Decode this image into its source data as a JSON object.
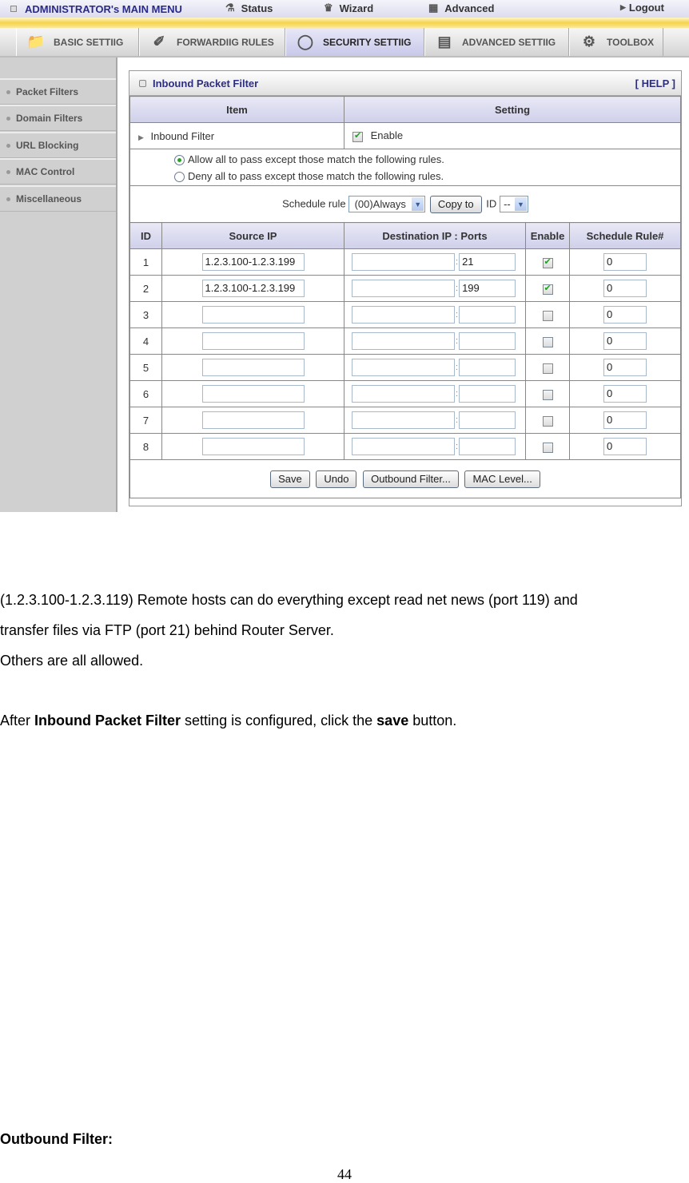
{
  "topbar": {
    "title": "ADMINISTRATOR's MAIN MENU",
    "items": [
      {
        "label": "Status",
        "icon": "status-icon"
      },
      {
        "label": "Wizard",
        "icon": "wizard-icon"
      },
      {
        "label": "Advanced",
        "icon": "advanced-icon"
      },
      {
        "label": "Logout",
        "icon": "arrow-right-icon"
      }
    ]
  },
  "tabs": [
    {
      "label": "BASIC SETTIIG",
      "icon": "folder-icon",
      "active": false
    },
    {
      "label": "FORWARDIIG RULES",
      "icon": "forwarding-icon",
      "active": false
    },
    {
      "label": "SECURITY SETTIIG",
      "icon": "lock-icon",
      "active": true
    },
    {
      "label": "ADVANCED SETTIIG",
      "icon": "advanced-setting-icon",
      "active": false
    },
    {
      "label": "TOOLBOX",
      "icon": "toolbox-icon",
      "active": false
    }
  ],
  "sidebar": {
    "items": [
      {
        "label": "Packet Filters"
      },
      {
        "label": "Domain Filters"
      },
      {
        "label": "URL Blocking"
      },
      {
        "label": "MAC Control"
      },
      {
        "label": "Miscellaneous"
      }
    ]
  },
  "panel": {
    "title": "Inbound Packet Filter",
    "help": "[ HELP ]",
    "header": {
      "item": "Item",
      "setting": "Setting"
    },
    "filter_label": "Inbound Filter",
    "enable_label": "Enable",
    "enable_checked": true,
    "rule_options": [
      {
        "label": "Allow all to pass except those match the following rules.",
        "selected": true
      },
      {
        "label": "Deny all to pass except those match the following rules.",
        "selected": false
      }
    ],
    "schedule_label": "Schedule rule",
    "schedule_value": "(00)Always",
    "copy_to_label": "Copy to",
    "id_label": "ID",
    "id_value": "--",
    "columns": [
      "ID",
      "Source IP",
      "Destination IP : Ports",
      "Enable",
      "Schedule Rule#"
    ],
    "rows": [
      {
        "id": "1",
        "source_ip": "1.2.3.100-1.2.3.199",
        "dest_ip": "",
        "port": "21",
        "enabled": true,
        "schedule": "0"
      },
      {
        "id": "2",
        "source_ip": "1.2.3.100-1.2.3.199",
        "dest_ip": "",
        "port": "199",
        "enabled": true,
        "schedule": "0"
      },
      {
        "id": "3",
        "source_ip": "",
        "dest_ip": "",
        "port": "",
        "enabled": false,
        "schedule": "0"
      },
      {
        "id": "4",
        "source_ip": "",
        "dest_ip": "",
        "port": "",
        "enabled": false,
        "schedule": "0"
      },
      {
        "id": "5",
        "source_ip": "",
        "dest_ip": "",
        "port": "",
        "enabled": false,
        "schedule": "0"
      },
      {
        "id": "6",
        "source_ip": "",
        "dest_ip": "",
        "port": "",
        "enabled": false,
        "schedule": "0"
      },
      {
        "id": "7",
        "source_ip": "",
        "dest_ip": "",
        "port": "",
        "enabled": false,
        "schedule": "0"
      },
      {
        "id": "8",
        "source_ip": "",
        "dest_ip": "",
        "port": "",
        "enabled": false,
        "schedule": "0"
      }
    ],
    "buttons": {
      "save": "Save",
      "undo": "Undo",
      "outbound": "Outbound Filter...",
      "mac": "MAC Level..."
    }
  },
  "doc": {
    "line1": "(1.2.3.100-1.2.3.119) Remote hosts can do everything except read net news (port 119) and",
    "line2": "transfer files via FTP (port 21) behind Router Server.",
    "line3": "Others are all allowed.",
    "after_prefix": "After ",
    "after_bold1": "Inbound Packet Filter",
    "after_mid": " setting is configured, click the ",
    "after_bold2": "save",
    "after_suffix": " button.",
    "heading": "Outbound Filter:",
    "page_number": "44"
  }
}
